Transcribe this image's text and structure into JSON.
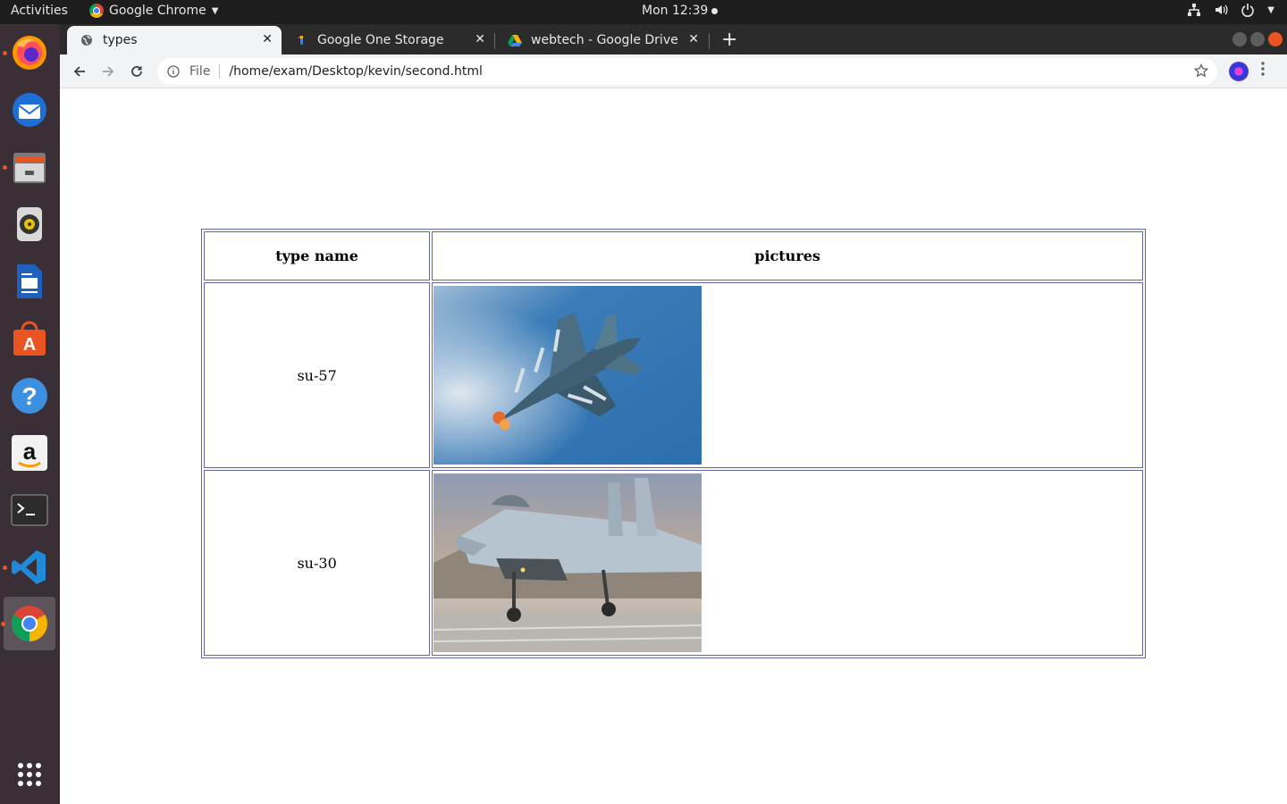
{
  "system_bar": {
    "activities": "Activities",
    "app_name": "Google Chrome",
    "clock": "Mon 12:39"
  },
  "dock": {
    "apps": [
      "firefox-icon",
      "thunderbird-icon",
      "files-icon",
      "rhythmbox-icon",
      "writer-icon",
      "software-icon",
      "help-icon",
      "amazon-icon",
      "terminal-icon",
      "vscode-icon",
      "chrome-icon",
      "show-apps-icon"
    ]
  },
  "browser": {
    "tabs": [
      {
        "title": "types",
        "close": "✕"
      },
      {
        "title": "Google One Storage",
        "close": "✕"
      },
      {
        "title": "webtech - Google Drive",
        "close": "✕"
      }
    ],
    "new_tab": "+",
    "omnibox": {
      "scheme": "File",
      "url": "/home/exam/Desktop/kevin/second.html"
    }
  },
  "page": {
    "table": {
      "headers": [
        "type name",
        "pictures"
      ],
      "rows": [
        {
          "type_name": "su-57",
          "picture": "aircraft photo"
        },
        {
          "type_name": "su-30",
          "picture": "aircraft photo"
        }
      ]
    }
  },
  "colors": {
    "table_border": "#6464a8",
    "dock_bg": "#3a2f37",
    "topbar_bg": "#1d1d1d",
    "accent": "#e95420"
  }
}
